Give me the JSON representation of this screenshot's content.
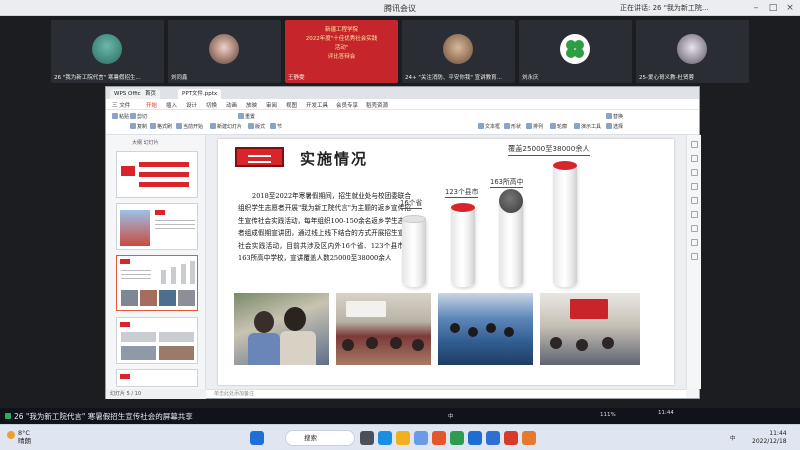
{
  "meeting": {
    "title": "腾讯会议",
    "status_prefix": "正在讲话: 26 \"我为新工院...",
    "participants": [
      {
        "label": "26 \"我为新工院代言\" 寒暑假招生..."
      },
      {
        "label": "刘同鑫"
      },
      {
        "label": "王静雯"
      },
      {
        "label": "24+ \"关注消防、平安你我\" 宣讲教育..."
      },
      {
        "label": "刘永庆"
      },
      {
        "label": "25-爱心哥义教-杜贤蓉"
      }
    ],
    "poster_lines": [
      "新疆工程学院",
      "2022年度\"十佳优秀社会实践活动\"",
      "评比答辩会"
    ]
  },
  "app": {
    "tabs": [
      "WPS Office",
      "首页",
      "PPT文件.pptx"
    ],
    "menu": [
      "三 文件",
      "开始",
      "插入",
      "设计",
      "切换",
      "动画",
      "放映",
      "审阅",
      "视图",
      "开发工具",
      "会员专享",
      "稻壳资源"
    ],
    "ribbon": [
      "粘贴",
      "剪切",
      "复制",
      "格式刷",
      "当前开始",
      "新建幻灯片",
      "版式",
      "节",
      "重置",
      "文本框",
      "形状",
      "排列",
      "轮廓",
      "演示工具",
      "替换",
      "选择"
    ],
    "thumb_header": "大纲  幻灯片",
    "notes": "单击此处添加备注",
    "status": "幻灯片 5 / 10",
    "zoom": "111%"
  },
  "slide": {
    "title": "实施情况",
    "body": "2018至2022年寒暑假期间，招生就业处与校团委联合组织学生志愿者开展\"我为新工院代言\"为主题的返乡宣传招生宣传社会实践活动，每年组织100-150余名返乡学生志愿者组成假期宣讲团，通过线上线下结合的方式开展招生宣传社会实践活动，目前共涉及区内外16个省、123个县市，163所高中学校，宣讲覆盖人数25000至38000余人",
    "stats": [
      {
        "label": "16个省",
        "value": 16
      },
      {
        "label": "123个县市",
        "value": 123
      },
      {
        "label": "163所高中",
        "value": 163
      },
      {
        "label": "覆盖25000至38000余人",
        "value": 38000
      }
    ]
  },
  "share": {
    "text": "26 \"我为新工院代言\" 寒暑假招生宣传社会的屏幕共享"
  },
  "taskbar": {
    "temp": "8°C",
    "weather": "晴朗",
    "search": "搜索",
    "lang": "中",
    "time": "11:44",
    "date": "2022/12/18"
  },
  "colors": {
    "brand_red": "#d8252b",
    "dark_cap": "#4a4a4a"
  }
}
